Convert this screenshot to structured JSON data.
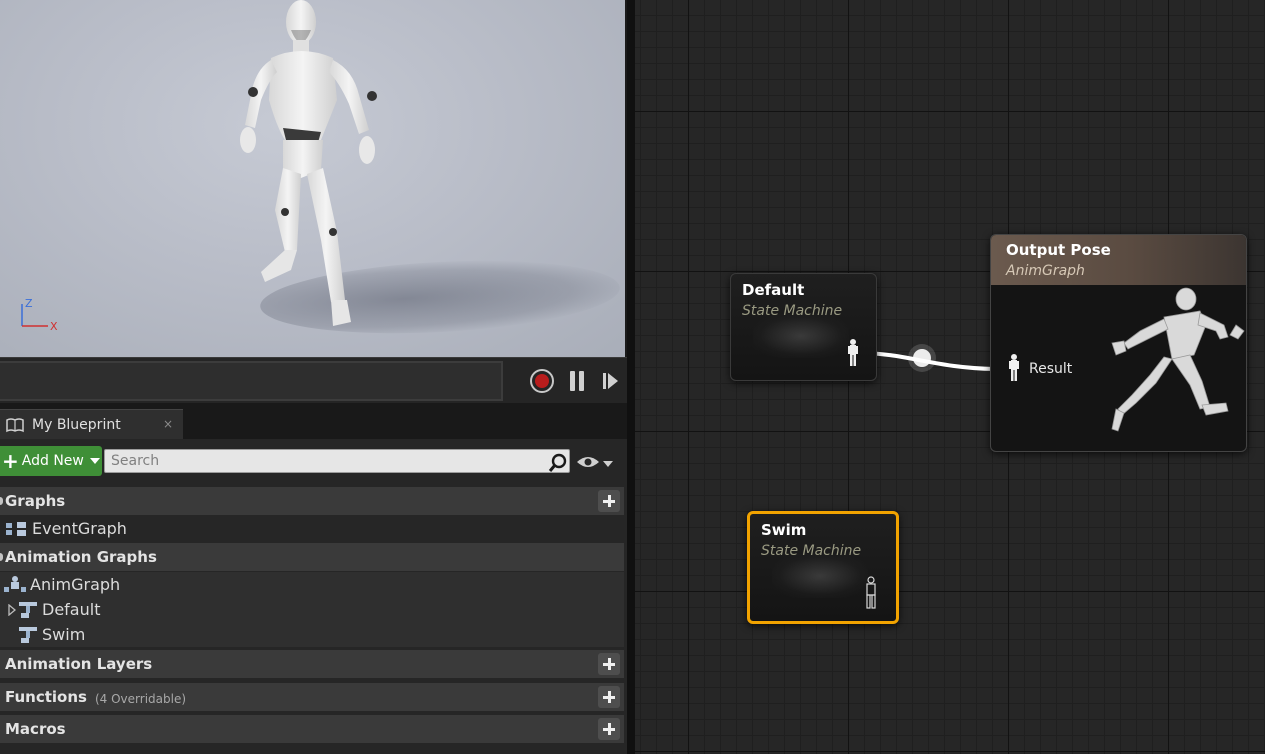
{
  "blueprint_tab": {
    "label": "My Blueprint",
    "close_glyph": "×"
  },
  "toolbar": {
    "add_new_label": "Add New",
    "search_placeholder": "Search"
  },
  "sections": {
    "graphs": "Graphs",
    "animation_graphs": "Animation Graphs",
    "animation_layers": "Animation Layers",
    "functions": "Functions",
    "functions_note": "(4 Overridable)",
    "macros": "Macros"
  },
  "items": {
    "event_graph": "EventGraph",
    "anim_graph": "AnimGraph",
    "default": "Default",
    "swim": "Swim"
  },
  "viewport": {
    "axis_z": "Z",
    "axis_x": "X"
  },
  "graph": {
    "nodes": {
      "default": {
        "title": "Default",
        "subtitle": "State Machine"
      },
      "swim": {
        "title": "Swim",
        "subtitle": "State Machine"
      },
      "output": {
        "title": "Output Pose",
        "subtitle": "AnimGraph",
        "pin": "Result"
      }
    }
  },
  "colors": {
    "add_new": "#3f8f37",
    "selected_node_border": "#f2a300",
    "record": "#b81d1d",
    "axis_x": "#d03030",
    "axis_z": "#3a6fd8"
  }
}
